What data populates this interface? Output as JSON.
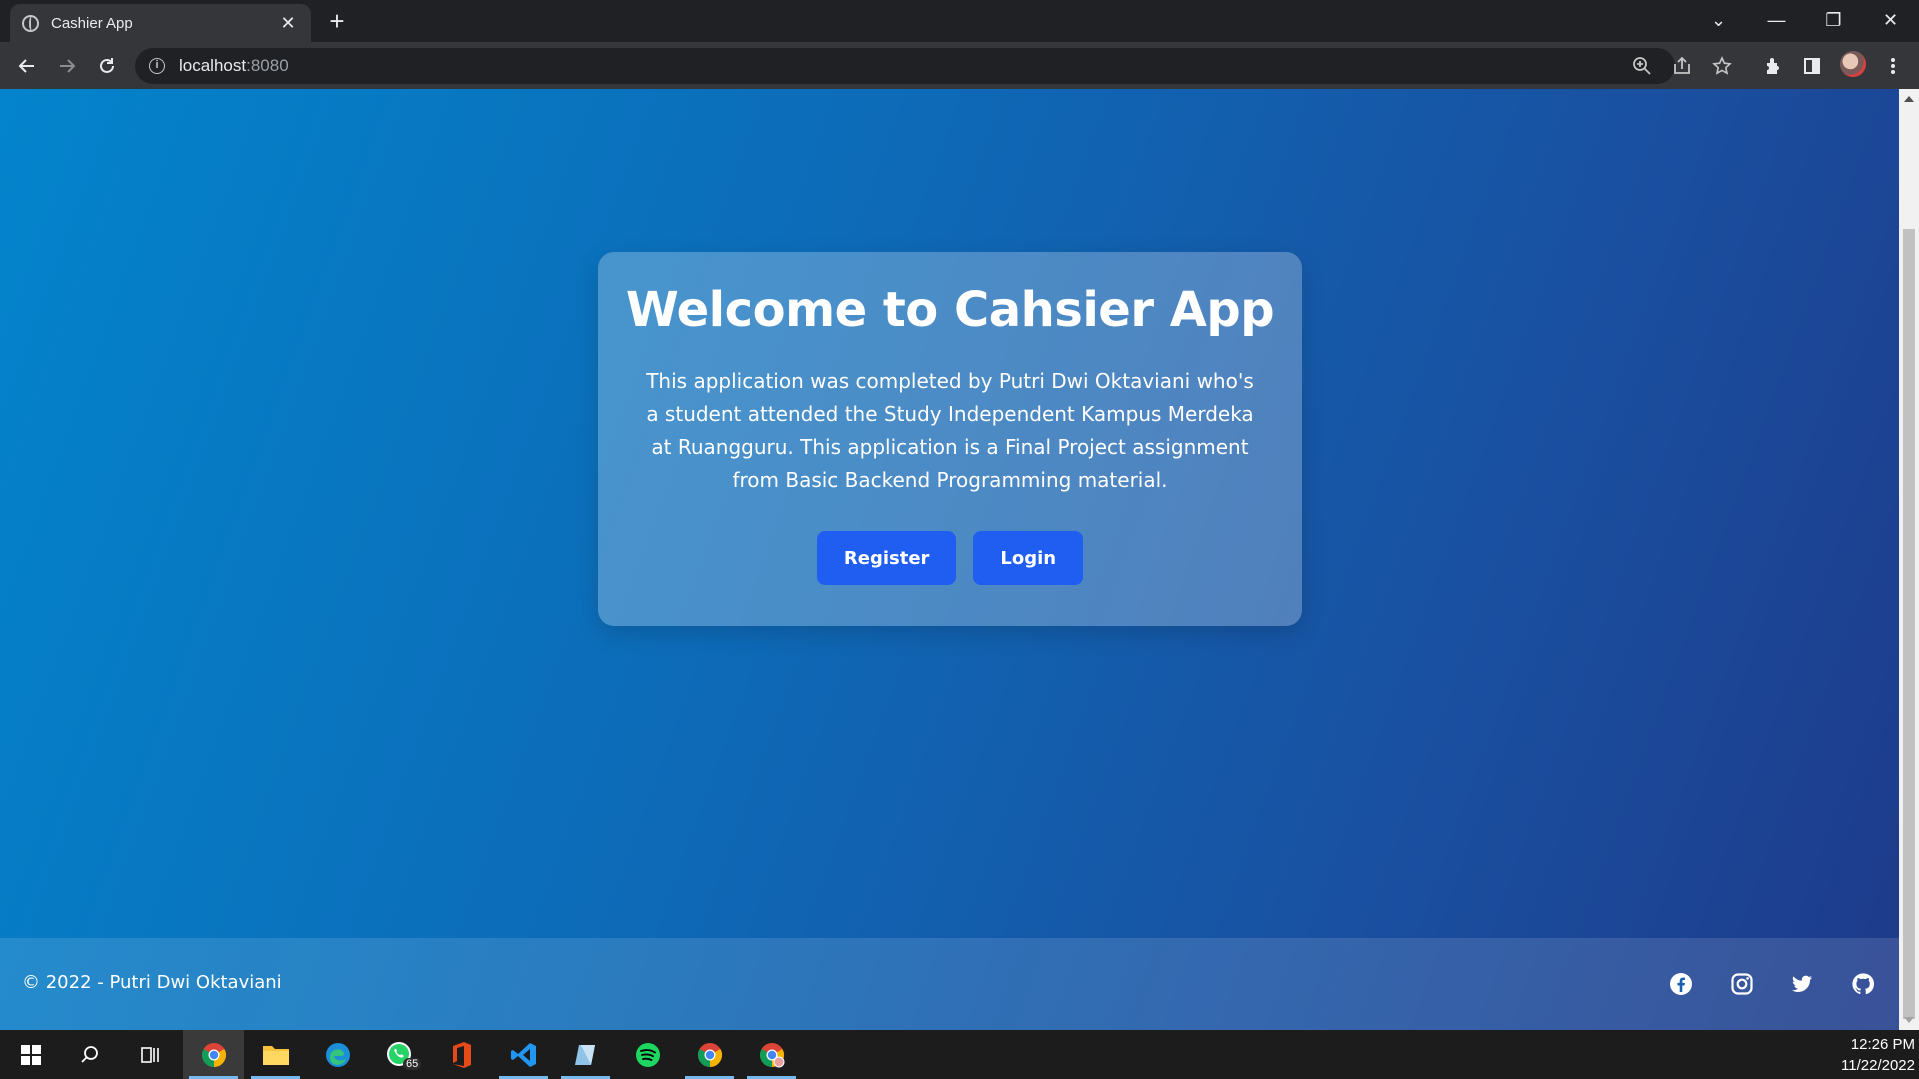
{
  "browser": {
    "tab_title": "Cashier App",
    "tab_close": "✕",
    "new_tab": "+",
    "url_host": "localhost",
    "url_port": ":8080",
    "window_controls": [
      "⌄",
      "—",
      "❐",
      "✕"
    ]
  },
  "page": {
    "heading": "Welcome to Cahsier App",
    "description": "This application was completed by Putri Dwi Oktaviani who's a student attended the Study Independent Kampus Merdeka at Ruangguru. This application is a Final Project assignment from Basic Backend Programming material.",
    "buttons": {
      "register": "Register",
      "login": "Login"
    },
    "footer_text": "© 2022 - Putri Dwi Oktaviani",
    "social_icons": [
      "facebook-icon",
      "instagram-icon",
      "twitter-icon",
      "github-icon"
    ]
  },
  "taskbar": {
    "whatsapp_badge": "65",
    "time": "12:26 PM",
    "date": "11/22/2022"
  },
  "colors": {
    "button_bg": "#1f5ef0",
    "gradient_start": "#0384cc",
    "gradient_end": "#1e3a8a"
  }
}
